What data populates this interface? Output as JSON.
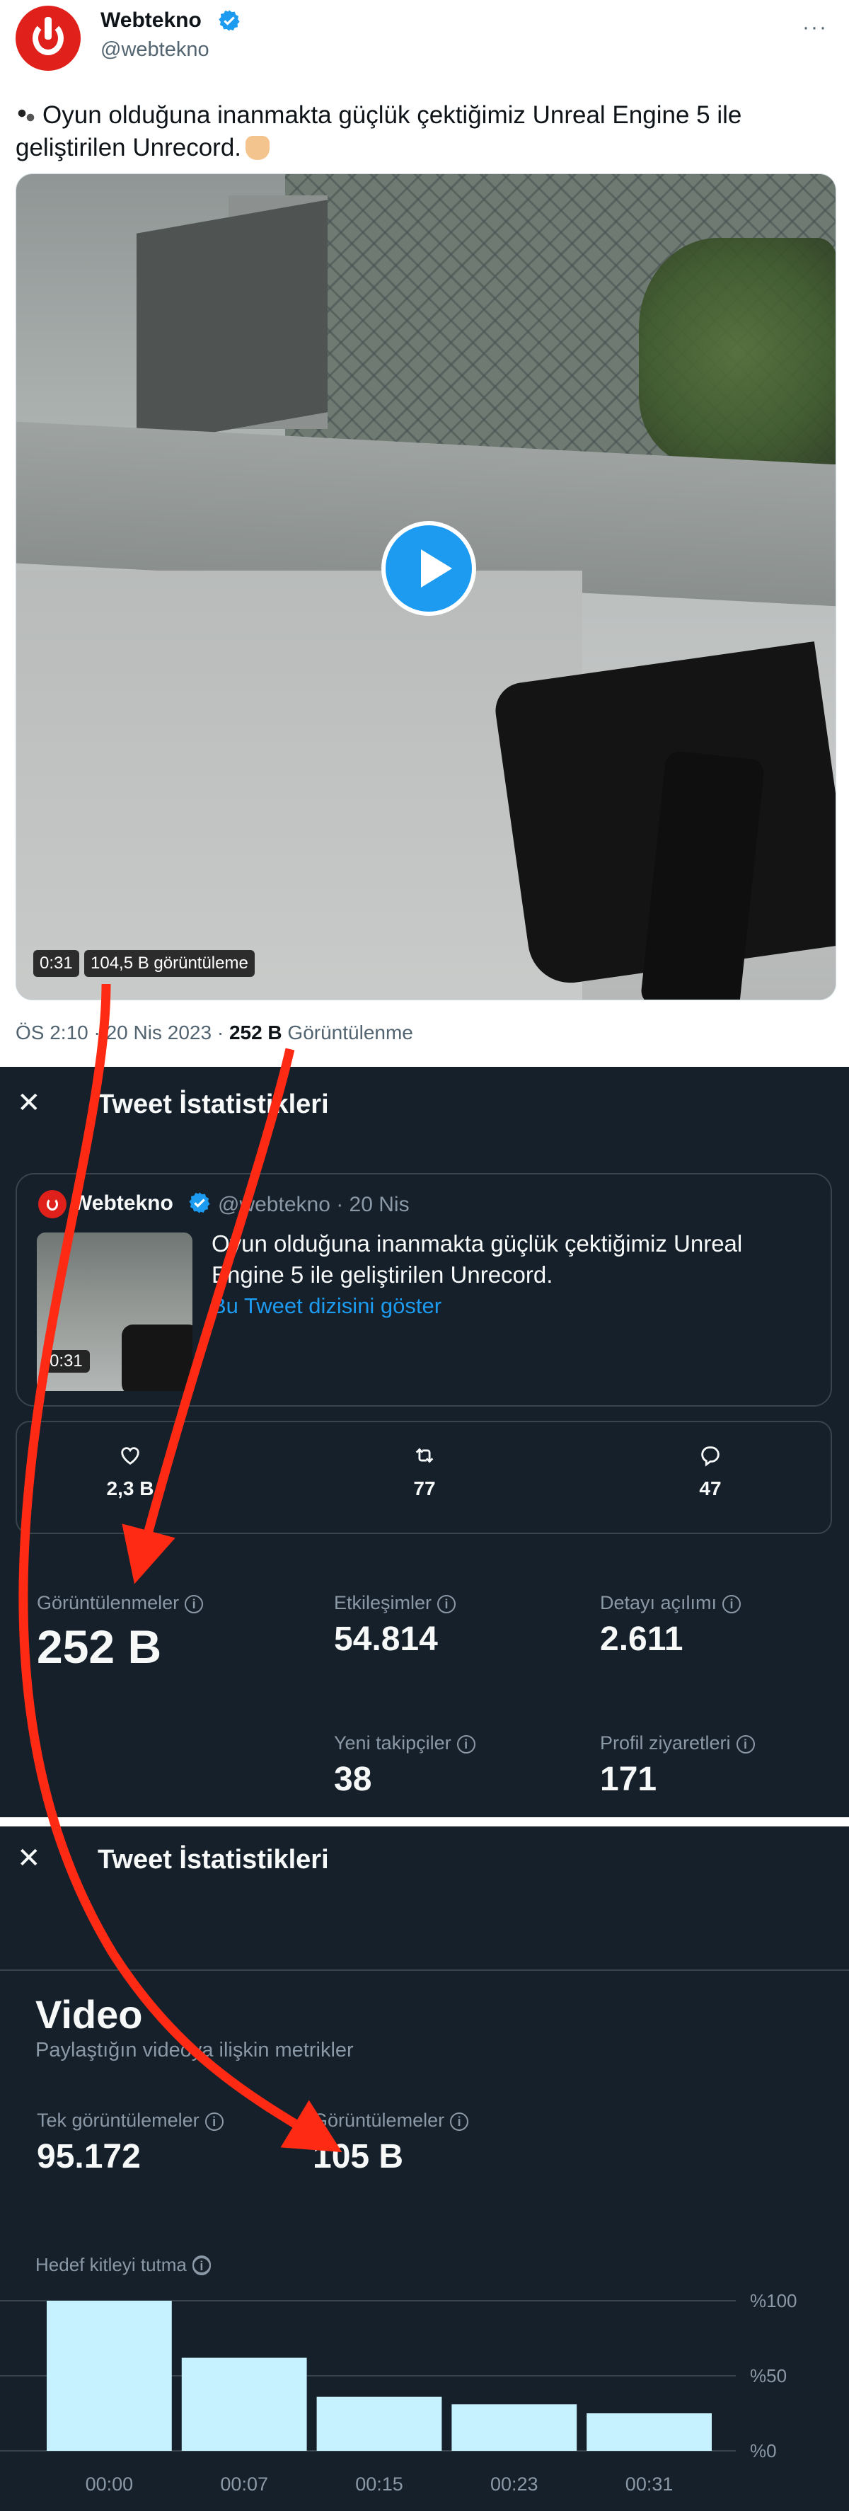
{
  "tweet": {
    "name": "Webtekno",
    "handle": "@webtekno",
    "more": "···",
    "text": "Oyun olduğuna inanmakta güçlük çektiğimiz Unreal Engine 5 ile geliştirilen Unrecord.",
    "video": {
      "duration": "0:31",
      "views": "104,5 B görüntüleme"
    },
    "meta": {
      "time_date": "ÖS 2:10 · 20 Nis 2023 · ",
      "views_count": "252 B",
      "views_label": " Görüntülenme"
    }
  },
  "stats": {
    "close": "✕",
    "title": "Tweet İstatistikleri",
    "quote": {
      "name": "Webtekno",
      "handle_date": "@webtekno · 20 Nis",
      "text": "Oyun olduğuna inanmakta güçlük çektiğimiz Unreal Engine 5 ile geliştirilen Unrecord.",
      "thumb_duration": "0:31",
      "thread_link": "Bu Tweet dizisini göster"
    },
    "engagement": [
      {
        "icon": "heart-icon",
        "value": "2,3 B"
      },
      {
        "icon": "retweet-icon",
        "value": "77"
      },
      {
        "icon": "reply-icon",
        "value": "47"
      }
    ],
    "metrics": {
      "impressions": {
        "label": "Görüntülenmeler",
        "value": "252 B"
      },
      "engagements": {
        "label": "Etkileşimler",
        "value": "54.814"
      },
      "detail_expands": {
        "label": "Detayı açılımı",
        "value": "2.611"
      },
      "new_followers": {
        "label": "Yeni takipçiler",
        "value": "38"
      },
      "profile_visits": {
        "label": "Profil ziyaretleri",
        "value": "171"
      }
    },
    "info_glyph": "i"
  },
  "video_stats": {
    "close": "✕",
    "title": "Tweet İstatistikleri",
    "heading": "Video",
    "subheading": "Paylaştığın videoya ilişkin metrikler",
    "unique_views": {
      "label": "Tek görüntülemeler",
      "value": "95.172"
    },
    "views": {
      "label": "Görüntülemeler",
      "value": "105 B"
    },
    "retention_label": "Hedef kitleyi tutma"
  },
  "chart_data": {
    "type": "bar",
    "title": "Hedef kitleyi tutma",
    "categories": [
      "00:00",
      "00:07",
      "00:15",
      "00:23",
      "00:31"
    ],
    "values": [
      100,
      62,
      36,
      31,
      25
    ],
    "y_ticks": [
      "%100",
      "%50",
      "%0"
    ],
    "ylim": [
      0,
      100
    ],
    "grid": true,
    "bar_color": "#c6f1fe"
  },
  "colors": {
    "accent": "#1d9bf0",
    "dark_bg": "#15202b",
    "arrow": "#ff2a14",
    "brand": "#e0201b"
  }
}
